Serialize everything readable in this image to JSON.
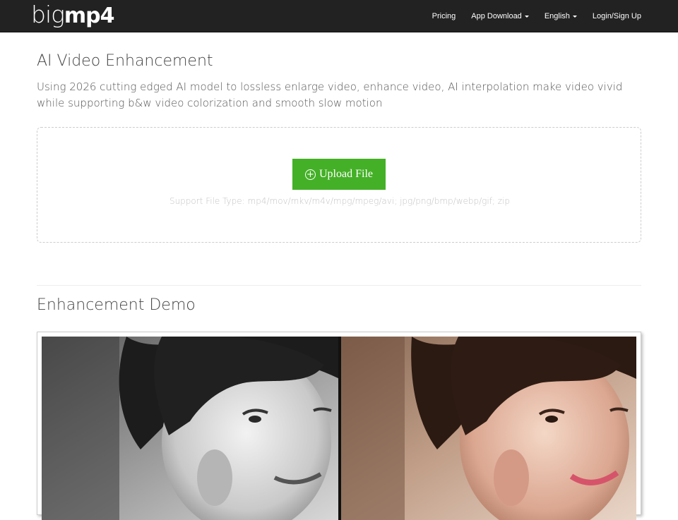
{
  "nav": {
    "logo_thin": "big",
    "logo_bold": "mp4",
    "items": [
      {
        "label": "Pricing",
        "dropdown": false
      },
      {
        "label": "App Download",
        "dropdown": true
      },
      {
        "label": "English",
        "dropdown": true
      },
      {
        "label": "Login/Sign Up",
        "dropdown": false
      }
    ]
  },
  "main": {
    "title": "AI Video Enhancement",
    "subtitle": "Using 2026 cutting edged AI model to lossless enlarge video, enhance video, AI interpolation make video vivid while supporting b&w video colorization and smooth slow motion"
  },
  "upload": {
    "button_label": "Upload File",
    "button_icon": "plus-circle-icon",
    "support_text": "Support File Type: mp4/mov/mkv/m4v/mpg/mpeg/avi; jpg/png/bmp/webp/gif; zip",
    "button_color": "#44b027"
  },
  "demo": {
    "title": "Enhancement Demo",
    "left_image": "black-and-white portrait",
    "right_image": "colorized portrait"
  }
}
